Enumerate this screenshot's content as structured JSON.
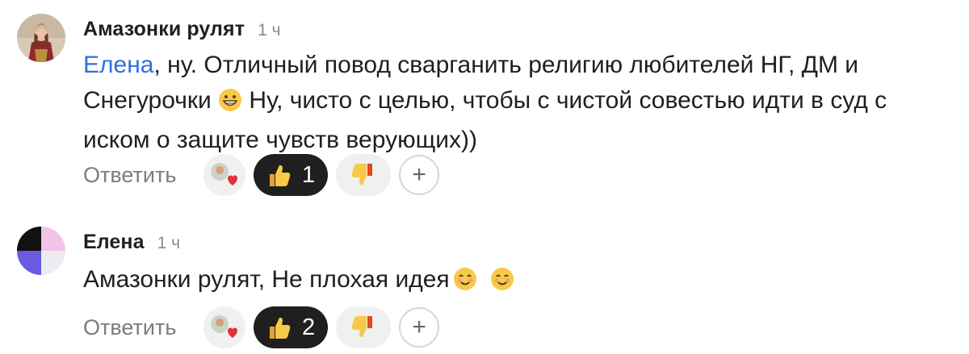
{
  "comments": [
    {
      "author": "Амазонки рулят",
      "time": "1 ч",
      "mention": "Елена",
      "text_before_emoji": ", ну. Отличный повод сварганить религию любителей НГ, ДМ и Снегурочки",
      "text_after_emoji": " Ну, чисто с целью, чтобы с чистой совестью идти в суд с иском о защите чувств верующих))",
      "reply_label": "Ответить",
      "like_count": "1",
      "avatar_icon": "warrior-woman-avatar"
    },
    {
      "author": "Елена",
      "time": "1 ч",
      "text": "Амазонки рулят, Не плохая идея",
      "reply_label": "Ответить",
      "like_count": "2",
      "avatar_icon": "abstract-shapes-avatar"
    }
  ],
  "colors": {
    "mention": "#2f6fe0",
    "like_pill": "#1f1f1f",
    "reaction_bg": "#f0f0f0",
    "muted_text": "#7c7c7c"
  }
}
